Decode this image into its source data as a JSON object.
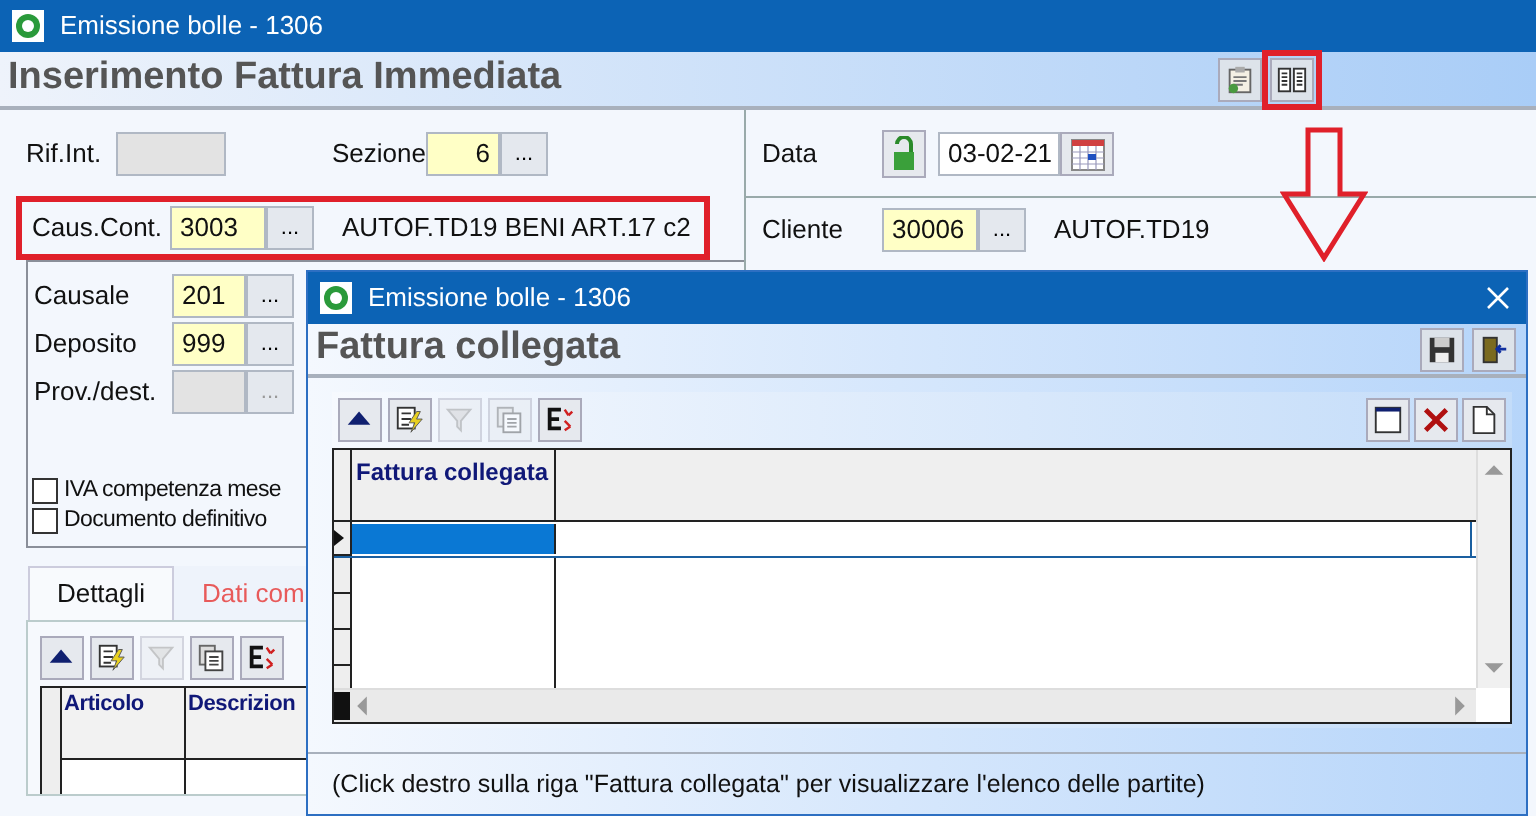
{
  "window": {
    "title": "Emissione bolle - 1306",
    "heading": "Inserimento Fattura Immediata",
    "header_tools": [
      {
        "kind": "report",
        "highlighted": false
      },
      {
        "kind": "columns",
        "highlighted": true
      }
    ]
  },
  "left_rows": [
    {
      "highlighted": false,
      "fields": [
        {
          "kind": "plain",
          "label": "Rif.Int.",
          "disabled": true
        },
        {
          "kind": "lookup",
          "label": "Sezione",
          "value": "6",
          "button": "..."
        }
      ]
    },
    {
      "highlighted": true,
      "fields": [
        {
          "kind": "lookup",
          "label": "Caus.Cont.",
          "value": "3003",
          "button": "...",
          "description": "AUTOF.TD19 BENI ART.17 c2"
        }
      ]
    }
  ],
  "right_rows": [
    {
      "fields": [
        {
          "kind": "date",
          "label": "Data",
          "locked": false,
          "value": "03-02-21"
        }
      ]
    },
    {
      "fields": [
        {
          "kind": "lookup",
          "label": "Cliente",
          "value": "30006",
          "button": "...",
          "description": "AUTOF.TD19"
        }
      ]
    }
  ],
  "detail_fields": [
    {
      "label": "Causale",
      "value": "201",
      "button": "...",
      "disabled": false
    },
    {
      "label": "Deposito",
      "value": "999",
      "button": "...",
      "disabled": false
    },
    {
      "label": "Prov./dest.",
      "button": "...",
      "disabled": true
    }
  ],
  "checkboxes": [
    {
      "label": "IVA competenza mese",
      "checked": false
    },
    {
      "label": "Documento definitivo",
      "checked": false
    }
  ],
  "tabs": [
    {
      "label": "Dettagli",
      "selected": true
    },
    {
      "label": "Dati com",
      "selected": false
    }
  ],
  "detail_grid": {
    "toolbar": [
      {
        "kind": "up",
        "disabled": false
      },
      {
        "kind": "edit",
        "disabled": false
      },
      {
        "kind": "filter",
        "disabled": true
      },
      {
        "kind": "copy",
        "disabled": false
      },
      {
        "kind": "export",
        "disabled": false
      }
    ],
    "columns": [
      "Articolo",
      "Descrizion"
    ]
  },
  "dialog": {
    "title": "Emissione bolle - 1306",
    "heading": "Fattura collegata",
    "header_tools": [
      {
        "kind": "save"
      },
      {
        "kind": "exit"
      }
    ],
    "grid": {
      "toolbar": [
        {
          "kind": "up",
          "disabled": false
        },
        {
          "kind": "edit",
          "disabled": false
        },
        {
          "kind": "filter",
          "disabled": true
        },
        {
          "kind": "copy",
          "disabled": true
        },
        {
          "kind": "export",
          "disabled": false
        }
      ],
      "toolbar_right": [
        {
          "kind": "window"
        },
        {
          "kind": "delete"
        },
        {
          "kind": "new"
        }
      ],
      "columns": [
        "Fattura collegata"
      ],
      "rows": [
        {
          "selected": true
        },
        {
          "selected": false
        },
        {
          "selected": false
        },
        {
          "selected": false
        }
      ]
    },
    "status": "(Click destro sulla riga \"Fattura collegata\" per visualizzare l'elenco delle partite)"
  }
}
